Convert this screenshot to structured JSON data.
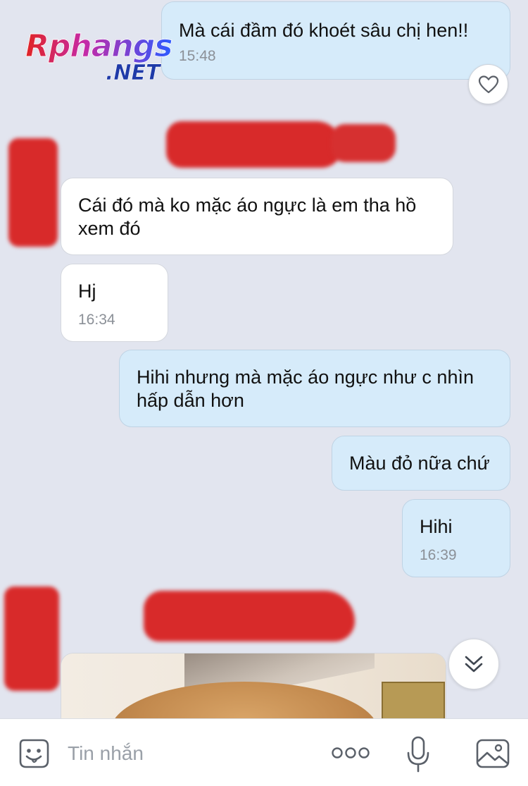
{
  "watermark": {
    "brand": "Rphangs",
    "suffix": ".NET"
  },
  "messages": [
    {
      "direction": "out",
      "text": "Mà cái đầm đó khoét sâu chị hen!!",
      "time": "15:48"
    },
    {
      "direction": "in",
      "text": "Cái đó mà ko mặc áo ngực là em tha hồ xem đó"
    },
    {
      "direction": "in",
      "text": "Hj",
      "time": "16:34"
    },
    {
      "direction": "out",
      "text": "Hihi nhưng mà mặc áo ngực như c nhìn hấp dẫn hơn"
    },
    {
      "direction": "out",
      "text": "Màu đỏ nữa chứ"
    },
    {
      "direction": "out",
      "text": "Hihi",
      "time": "16:39"
    }
  ],
  "reaction_icon": "heart-outline-icon",
  "scroll_down_icon": "double-chevron-down-icon",
  "composer": {
    "placeholder": "Tin nhắn",
    "icons": [
      "sticker-smiley-icon",
      "more-options-icon",
      "microphone-icon",
      "image-gallery-icon"
    ]
  },
  "colors": {
    "background": "#e2e5ef",
    "outgoing_bubble": "#d6ebfa",
    "incoming_bubble": "#ffffff",
    "timestamp": "#8b9097",
    "redaction": "#d82a2a"
  }
}
